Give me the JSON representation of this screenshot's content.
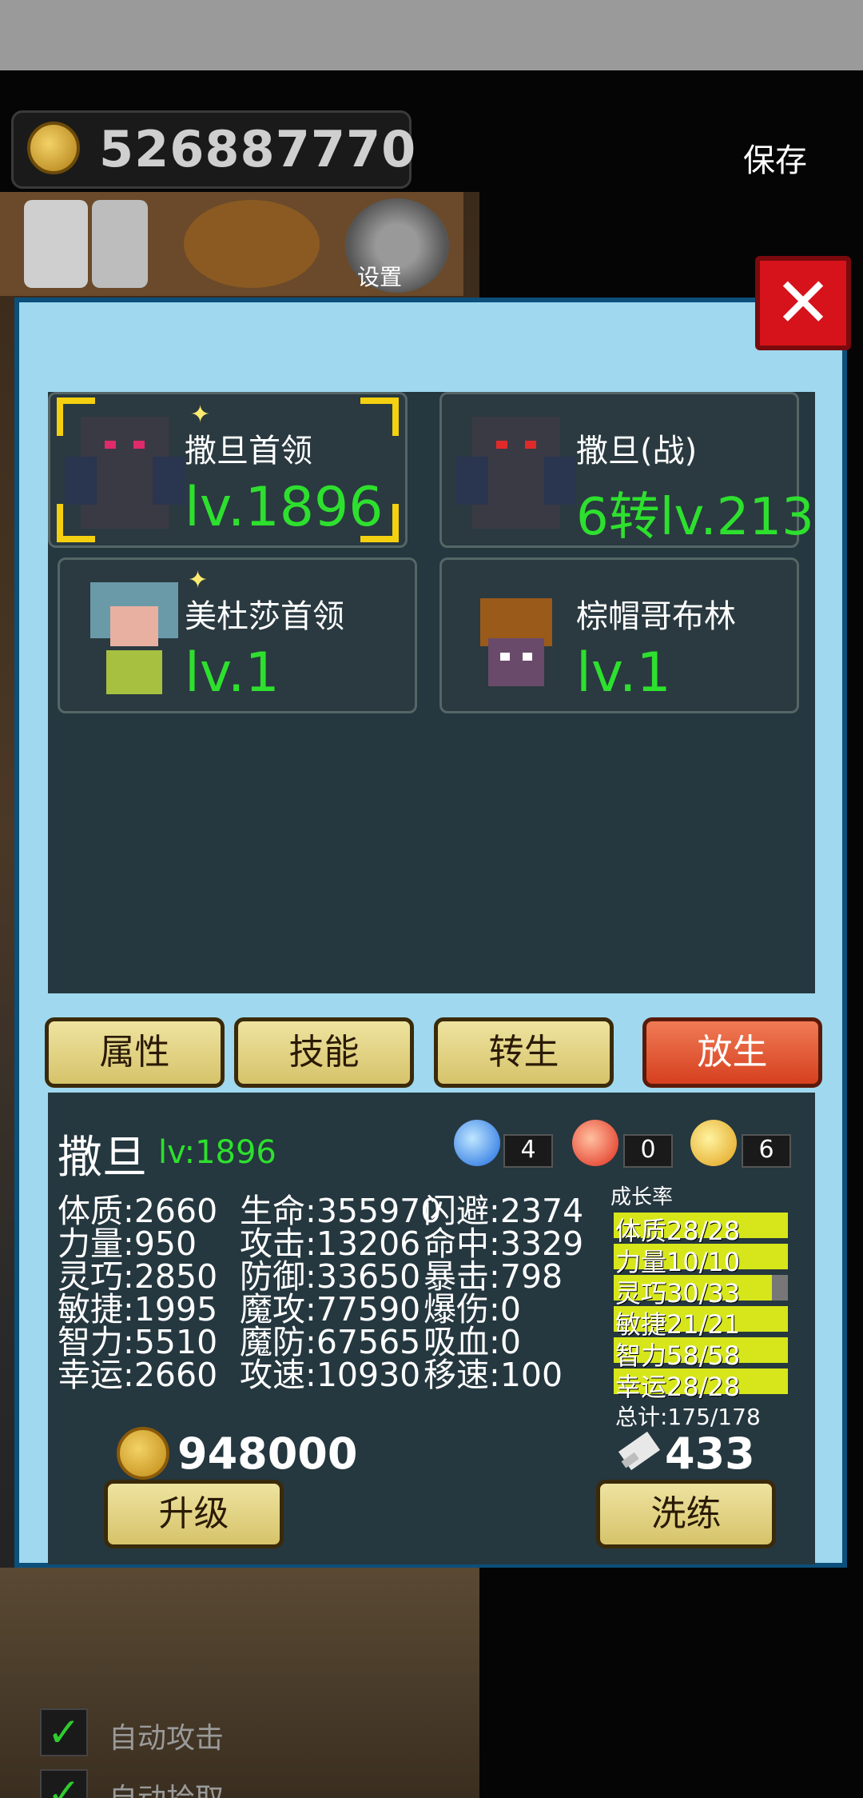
{
  "header": {
    "gold_amount": "526887770",
    "save_label": "保存",
    "settings_label": "设置"
  },
  "monsters": [
    {
      "name": "撒旦首领",
      "level": "lv.1896",
      "selected": true
    },
    {
      "name": "撒旦(战)",
      "level": "6转lv.213",
      "selected": false
    },
    {
      "name": "美杜莎首领",
      "level": "lv.1",
      "selected": false
    },
    {
      "name": "棕帽哥布林",
      "level": "lv.1",
      "selected": false
    }
  ],
  "tabs": {
    "attributes": "属性",
    "skills": "技能",
    "rebirth": "转生",
    "release": "放生"
  },
  "detail": {
    "name": "撒旦",
    "level": "lv:1896",
    "gems": [
      {
        "color": "blue",
        "count": "4"
      },
      {
        "color": "red",
        "count": "0"
      },
      {
        "color": "yellow",
        "count": "6"
      }
    ],
    "stats_col1": [
      "体质:2660",
      "力量:950",
      "灵巧:2850",
      "敏捷:1995",
      "智力:5510",
      "幸运:2660"
    ],
    "stats_col2": [
      "生命:355970",
      "攻击:13206",
      "防御:33650",
      "魔攻:77590",
      "魔防:67565",
      "攻速:10930"
    ],
    "stats_col3": [
      "闪避:2374",
      "命中:3329",
      "暴击:798",
      "爆伤:0",
      "吸血:0",
      "移速:100"
    ],
    "growth_label": "成长率",
    "growth": [
      {
        "text": "体质28/28",
        "fill": 1.0
      },
      {
        "text": "力量10/10",
        "fill": 1.0
      },
      {
        "text": "灵巧30/33",
        "fill": 0.909
      },
      {
        "text": "敏捷21/21",
        "fill": 1.0
      },
      {
        "text": "智力58/58",
        "fill": 1.0
      },
      {
        "text": "幸运28/28",
        "fill": 1.0
      }
    ],
    "growth_total": "总计:175/178",
    "upgrade_cost": "948000",
    "reroll_cost": "433",
    "upgrade_label": "升级",
    "reroll_label": "洗练"
  },
  "bottom": {
    "auto_attack": "自动攻击",
    "auto_pickup": "自动拾取"
  },
  "colors": {
    "dialog_bg": "#9fd8ef",
    "panel_bg": "#25373f",
    "level_green": "#2ee02e",
    "close_red": "#d6131b"
  }
}
